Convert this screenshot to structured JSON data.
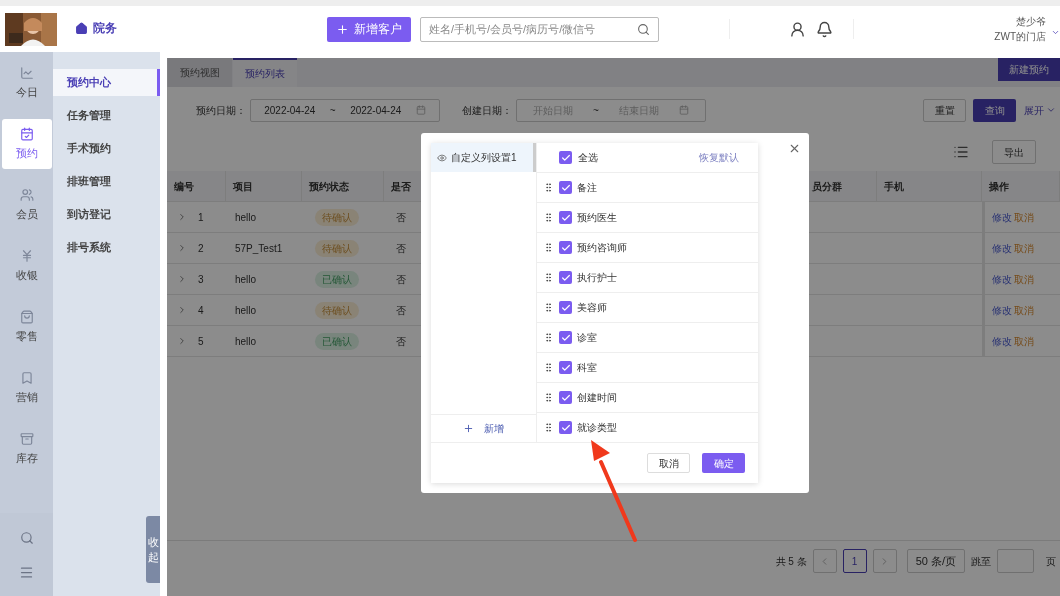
{
  "header": {
    "nav_tab": {
      "label": "院务",
      "selected": true
    },
    "new_customer_button": "新增客户",
    "search": {
      "placeholder": "姓名/手机号/会员号/病历号/微信号"
    },
    "user": {
      "name": "楚少爷",
      "store": "ZWT的门店"
    }
  },
  "rail": [
    {
      "label": "今日",
      "selected": false
    },
    {
      "label": "预约",
      "selected": true
    },
    {
      "label": "会员",
      "selected": false
    },
    {
      "label": "收银",
      "selected": false
    },
    {
      "label": "零售",
      "selected": false
    },
    {
      "label": "营销",
      "selected": false
    },
    {
      "label": "库存",
      "selected": false
    }
  ],
  "submenu": [
    {
      "label": "预约中心",
      "selected": true
    },
    {
      "label": "任务管理",
      "selected": false
    },
    {
      "label": "手术预约",
      "selected": false
    },
    {
      "label": "排班管理",
      "selected": false
    },
    {
      "label": "到访登记",
      "selected": false
    },
    {
      "label": "排号系统",
      "selected": false
    }
  ],
  "collapse_tab": "收起",
  "tabs": [
    {
      "label": "预约视图",
      "selected": false
    },
    {
      "label": "预约列表",
      "selected": true
    }
  ],
  "new_appointment_button": "新建预约",
  "filters": [
    {
      "label": "预约日期：",
      "start": "2022-04-24",
      "end": "2022-04-24",
      "separator": "~"
    },
    {
      "label": "创建日期：",
      "start_placeholder": "开始日期",
      "end_placeholder": "结束日期",
      "separator": "~"
    }
  ],
  "reset_button": "重置",
  "query_button": "查询",
  "expand_link": "展开",
  "export_button": "导出",
  "table": {
    "columns_left": [
      "编号",
      "项目",
      "预约状态",
      "是否"
    ],
    "columns_right": [
      "员分群",
      "手机",
      "操作"
    ],
    "rows": [
      {
        "no": "1",
        "item": "hello",
        "status": {
          "label": "待确认",
          "kind": "pending"
        },
        "arrived": "否",
        "actions": [
          "修改",
          "取消"
        ]
      },
      {
        "no": "2",
        "item": "57P_Test1",
        "status": {
          "label": "待确认",
          "kind": "pending"
        },
        "arrived": "否",
        "actions": [
          "修改",
          "取消"
        ]
      },
      {
        "no": "3",
        "item": "hello",
        "status": {
          "label": "已确认",
          "kind": "confirmed"
        },
        "arrived": "否",
        "actions": [
          "修改",
          "取消"
        ]
      },
      {
        "no": "4",
        "item": "hello",
        "status": {
          "label": "待确认",
          "kind": "pending"
        },
        "arrived": "否",
        "actions": [
          "修改",
          "取消"
        ]
      },
      {
        "no": "5",
        "item": "hello",
        "status": {
          "label": "已确认",
          "kind": "confirmed"
        },
        "arrived": "否",
        "actions": [
          "修改",
          "取消"
        ]
      }
    ]
  },
  "pagination": {
    "total": "共 5 条",
    "page": "1",
    "page_size": "50 条/页",
    "jump_label": "跳至",
    "page_suffix": "页"
  },
  "dialog": {
    "presets": [
      {
        "label": "自定义列设置1",
        "selected": true
      }
    ],
    "add_preset": "新增",
    "select_all": {
      "label": "全选",
      "checked": true
    },
    "restore_default": "恢复默认",
    "columns": [
      {
        "label": "备注",
        "checked": true
      },
      {
        "label": "预约医生",
        "checked": true
      },
      {
        "label": "预约咨询师",
        "checked": true
      },
      {
        "label": "执行护士",
        "checked": true
      },
      {
        "label": "美容师",
        "checked": true
      },
      {
        "label": "诊室",
        "checked": true
      },
      {
        "label": "科室",
        "checked": true
      },
      {
        "label": "创建时间",
        "checked": true
      },
      {
        "label": "就诊类型",
        "checked": true
      }
    ],
    "cancel": "取消",
    "confirm": "确定"
  }
}
